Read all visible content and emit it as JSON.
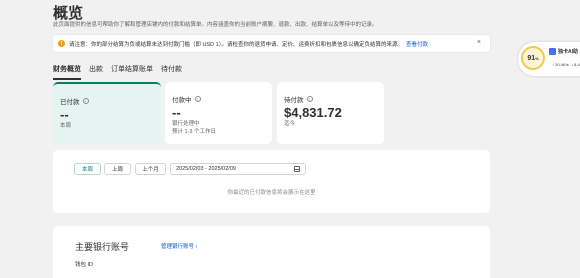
{
  "header": {
    "title": "概览",
    "subtitle": "此页面提供的信息可帮助你了解和管理店铺内的付款和结算单。内容涵盖你的当前账户摘要、退款、出款、结算单以及等待中的记录。"
  },
  "notice": {
    "icon": "warning-icon",
    "text": "请注意：你的部分结算为负或结算未达到付款门槛（即 USD 1）。请检查你的退货申请、定价、运费折扣和包裹信息以确定负结算的来源。",
    "link": "查看付款",
    "close": "×"
  },
  "tabs": [
    "财务概览",
    "出款",
    "订单结算账单",
    "待付款"
  ],
  "cards": [
    {
      "label": "已付款",
      "value": "--",
      "sub1": "本周",
      "sub2": ""
    },
    {
      "label": "付款中",
      "value": "--",
      "sub1": "银行处理中",
      "sub2": "预计 1-3 个工作日"
    },
    {
      "label": "待付款",
      "value": "$4,831.72",
      "sub1": "迄今",
      "sub2": ""
    }
  ],
  "filters": {
    "this_week": "本周",
    "last_week": "上周",
    "last_month": "上个月",
    "date_range": "2025/02/03 - 2025/02/09",
    "empty_message": "你最近的已付款信息将会展示在这里"
  },
  "bank": {
    "title": "主要银行账号",
    "manage_link": "管理银行账号",
    "chevron": "›",
    "wallet_id_label": "钱包 ID"
  },
  "widget": {
    "score": "91",
    "score_unit": "%",
    "name": "独卡AI助",
    "stat1": "↑ 20.4K/s",
    "stat2": "↓ 8.4"
  },
  "colors": {
    "accent": "#0a7b6a",
    "link": "#005bd3",
    "warning": "#e8a317"
  }
}
